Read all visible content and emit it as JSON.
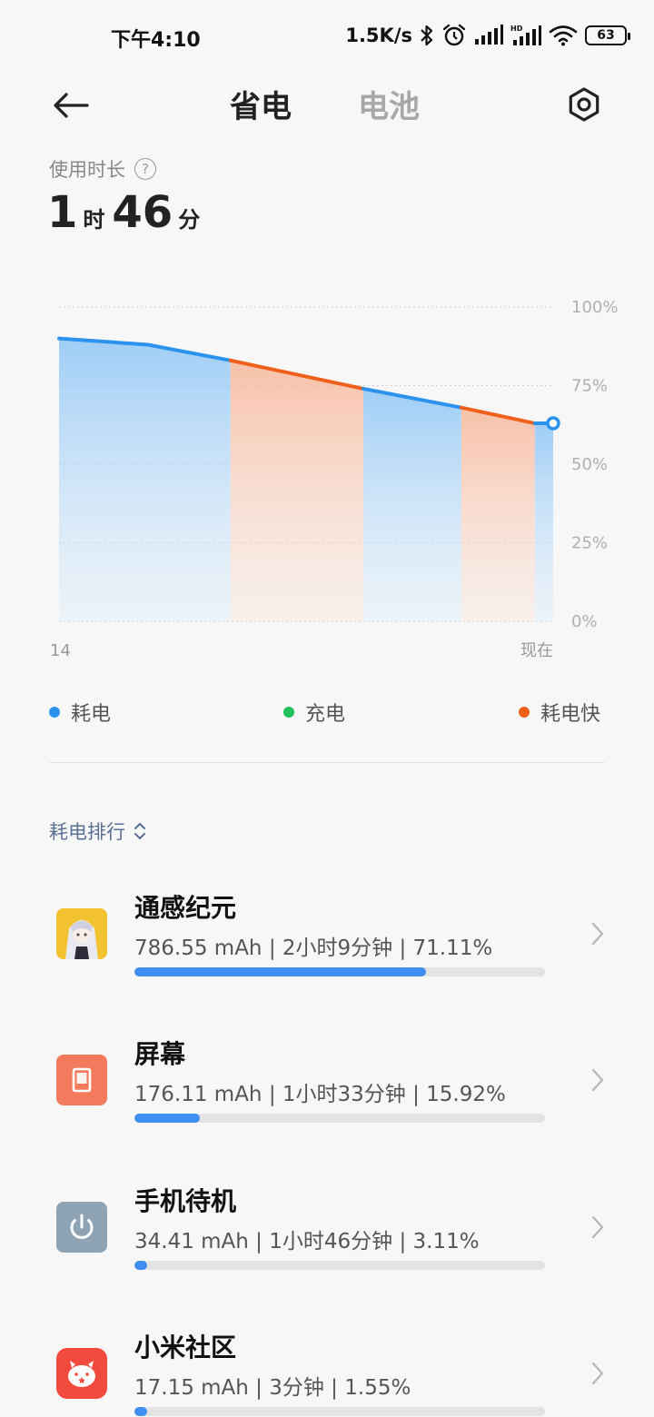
{
  "status_bar": {
    "time": "下午4:10",
    "net_speed": "1.5K/s",
    "battery_level": "63",
    "icons": [
      "bluetooth-icon",
      "alarm-icon",
      "signal-icon",
      "hd-signal-icon",
      "wifi-icon",
      "battery-icon"
    ]
  },
  "nav": {
    "tab_active": "省电",
    "tab_inactive": "电池",
    "back_icon": "back-arrow-icon",
    "settings_icon": "gear-icon"
  },
  "usage": {
    "label": "使用时长",
    "help": "?",
    "hours": "1",
    "hours_unit": "时",
    "minutes": "46",
    "minutes_unit": "分"
  },
  "chart_data": {
    "type": "area",
    "y_ticks": [
      "100%",
      "75%",
      "50%",
      "25%",
      "0%"
    ],
    "ylim": [
      0,
      100
    ],
    "x_labels": [
      "14",
      "现在"
    ],
    "points": [
      {
        "x": 0,
        "y": 90
      },
      {
        "x": 0.18,
        "y": 88
      },
      {
        "x": 0.347,
        "y": 83
      },
      {
        "x": 0.616,
        "y": 74
      },
      {
        "x": 0.814,
        "y": 68
      },
      {
        "x": 0.963,
        "y": 63
      },
      {
        "x": 1,
        "y": 63
      }
    ],
    "segments": [
      {
        "kind": "drain",
        "from": 0,
        "to": 0.347
      },
      {
        "kind": "fast_drain",
        "from": 0.347,
        "to": 0.616
      },
      {
        "kind": "drain",
        "from": 0.616,
        "to": 0.814
      },
      {
        "kind": "fast_drain",
        "from": 0.814,
        "to": 0.963
      },
      {
        "kind": "drain",
        "from": 0.963,
        "to": 1
      }
    ],
    "colors": {
      "drain": "#2b92ee",
      "charge": "#1fc25a",
      "fast_drain": "#f0601d"
    }
  },
  "legend": {
    "drain": "耗电",
    "charge": "充电",
    "fast_drain": "耗电快"
  },
  "ranking": {
    "header": "耗电排行",
    "items": [
      {
        "name": "通感纪元",
        "stats": "786.55 mAh | 2小时9分钟 | 71.11%",
        "percent": 71.11,
        "icon": "game-avatar-icon"
      },
      {
        "name": "屏幕",
        "stats": "176.11 mAh | 1小时33分钟 | 15.92%",
        "percent": 15.92,
        "icon": "screen-icon"
      },
      {
        "name": "手机待机",
        "stats": "34.41 mAh | 1小时46分钟 | 3.11%",
        "percent": 3.11,
        "icon": "power-icon"
      },
      {
        "name": "小米社区",
        "stats": "17.15 mAh | 3分钟 | 1.55%",
        "percent": 1.55,
        "icon": "mi-community-icon"
      }
    ]
  }
}
